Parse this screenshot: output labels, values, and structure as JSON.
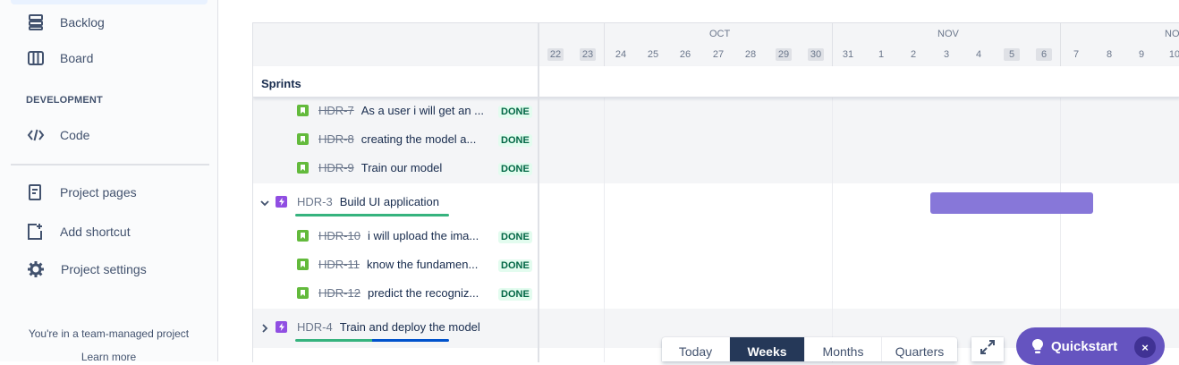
{
  "sidebar": {
    "items": [
      {
        "label": "Backlog",
        "icon": "backlog-icon"
      },
      {
        "label": "Board",
        "icon": "board-icon"
      }
    ],
    "section_title": "DEVELOPMENT",
    "dev_items": [
      {
        "label": "Code",
        "icon": "code-icon"
      }
    ],
    "bottom_items": [
      {
        "label": "Project pages",
        "icon": "page-icon"
      },
      {
        "label": "Add shortcut",
        "icon": "add-shortcut-icon"
      },
      {
        "label": "Project settings",
        "icon": "gear-icon"
      }
    ],
    "footer_text": "You're in a team-managed project",
    "footer_link": "Learn more"
  },
  "timeline": {
    "months": [
      "OCT",
      "NOV",
      "NO"
    ],
    "days": [
      "22",
      "23",
      "24",
      "25",
      "26",
      "27",
      "28",
      "29",
      "30",
      "31",
      "1",
      "2",
      "3",
      "4",
      "5",
      "6",
      "7",
      "8",
      "9",
      "10"
    ],
    "weekend_days": [
      "22",
      "23",
      "29",
      "30",
      "5",
      "6"
    ],
    "sprints_label": "Sprints",
    "issues": [
      {
        "key": "HDR-7",
        "summary": "As a user i will get an ...",
        "status": "DONE",
        "type": "story"
      },
      {
        "key": "HDR-8",
        "summary": "creating the model a...",
        "status": "DONE",
        "type": "story"
      },
      {
        "key": "HDR-9",
        "summary": "Train our model",
        "status": "DONE",
        "type": "story"
      },
      {
        "key": "HDR-3",
        "summary": "Build UI application",
        "status": "",
        "type": "epic",
        "expanded": true,
        "progress_done": 1.0
      },
      {
        "key": "HDR-10",
        "summary": "i will upload the ima...",
        "status": "DONE",
        "type": "story"
      },
      {
        "key": "HDR-11",
        "summary": "know the fundamen...",
        "status": "DONE",
        "type": "story"
      },
      {
        "key": "HDR-12",
        "summary": "predict the recogniz...",
        "status": "DONE",
        "type": "story"
      },
      {
        "key": "HDR-4",
        "summary": "Train and deploy the model",
        "status": "",
        "type": "epic",
        "expanded": false,
        "progress_done": 0.5,
        "progress_in_progress": 0.5
      }
    ],
    "epic_bar_color": "#8777d9"
  },
  "controls": {
    "today": "Today",
    "weeks": "Weeks",
    "months": "Months",
    "quarters": "Quarters",
    "active": "Weeks"
  },
  "quickstart": {
    "label": "Quickstart",
    "close": "×"
  },
  "colors": {
    "done_green": "#36b37e",
    "in_progress_blue": "#0052cc",
    "quickstart_purple": "#6554c0",
    "active_zoom": "#253858"
  }
}
